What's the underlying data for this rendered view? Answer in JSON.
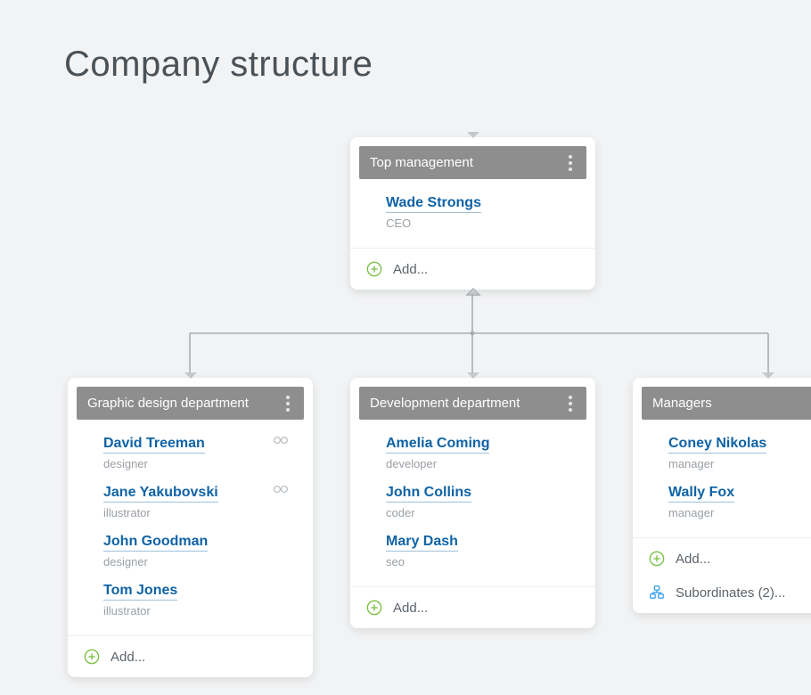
{
  "page": {
    "title": "Company structure"
  },
  "actions": {
    "add": "Add..."
  },
  "org": {
    "top": {
      "title": "Top management",
      "people": [
        {
          "name": "Wade Strongs",
          "role": "CEO"
        }
      ]
    },
    "children": [
      {
        "title": "Graphic design department",
        "people": [
          {
            "name": "David Treeman",
            "role": "designer",
            "observer": true
          },
          {
            "name": "Jane Yakubovski",
            "role": "illustrator",
            "observer": true
          },
          {
            "name": "John Goodman",
            "role": "designer"
          },
          {
            "name": "Tom Jones",
            "role": "illustrator"
          }
        ]
      },
      {
        "title": "Development department",
        "people": [
          {
            "name": "Amelia Coming",
            "role": "developer"
          },
          {
            "name": "John Collins",
            "role": "coder"
          },
          {
            "name": "Mary Dash",
            "role": "seo"
          }
        ]
      },
      {
        "title": "Managers",
        "people": [
          {
            "name": "Coney Nikolas",
            "role": "manager"
          },
          {
            "name": "Wally Fox",
            "role": "manager"
          }
        ],
        "subordinates_label": "Subordinates (2)..."
      }
    ]
  }
}
